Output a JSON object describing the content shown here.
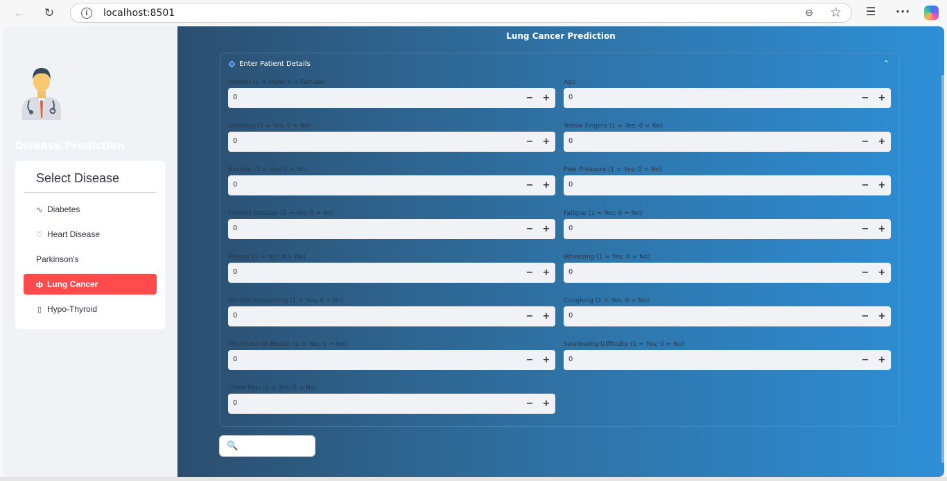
{
  "browser": {
    "url": "localhost:8501",
    "back_glyph": "←",
    "refresh_glyph": "↻",
    "info_glyph": "i",
    "zoom_glyph": "⊖",
    "favorite_glyph": "☆",
    "favorites_glyph": "☰",
    "more_glyph": "···"
  },
  "sidebar": {
    "title": "Disease Prediction",
    "menu_title": "Select Disease",
    "items": [
      {
        "label": "Diabetes",
        "icon": "activity-icon",
        "glyph": "∿",
        "active": false
      },
      {
        "label": "Heart Disease",
        "icon": "heart-icon",
        "glyph": "♡",
        "active": false
      },
      {
        "label": "Parkinson's",
        "icon": "",
        "glyph": "",
        "active": false
      },
      {
        "label": "Lung Cancer",
        "icon": "lungs-icon",
        "glyph": "ф",
        "active": true
      },
      {
        "label": "Hypo-Thyroid",
        "icon": "thermometer-icon",
        "glyph": "▯",
        "active": false
      }
    ],
    "accent_color": "#ff4b4b"
  },
  "main": {
    "title": "Lung Cancer Prediction",
    "expander_label": "Enter Patient Details",
    "collapse_glyph": "⌃",
    "fields": [
      {
        "label": "Gender (1 = Male; 0 = Female)",
        "value": "0"
      },
      {
        "label": "Age",
        "value": "0"
      },
      {
        "label": "Smoking (1 = Yes; 0 = No)",
        "value": "0"
      },
      {
        "label": "Yellow Fingers (1 = Yes; 0 = No)",
        "value": "0"
      },
      {
        "label": "Anxiety (1 = Yes; 0 = No)",
        "value": "0"
      },
      {
        "label": "Peer Pressure (1 = Yes; 0 = No)",
        "value": "0"
      },
      {
        "label": "Chronic Disease (1 = Yes; 0 = No)",
        "value": "0"
      },
      {
        "label": "Fatigue (1 = Yes; 0 = No)",
        "value": "0"
      },
      {
        "label": "Allergy (1 = Yes; 0 = No)",
        "value": "0"
      },
      {
        "label": "Wheezing (1 = Yes; 0 = No)",
        "value": "0"
      },
      {
        "label": "Alcohol Consuming (1 = Yes; 0 = No)",
        "value": "0"
      },
      {
        "label": "Coughing (1 = Yes; 0 = No)",
        "value": "0"
      },
      {
        "label": "Shortness Of Breath (1 = Yes; 0 = No)",
        "value": "0"
      },
      {
        "label": "Swallowing Difficulty (1 = Yes; 0 = No)",
        "value": "0"
      },
      {
        "label": "Chest Pain (1 = Yes; 0 = No)",
        "value": "0"
      }
    ],
    "minus_glyph": "−",
    "plus_glyph": "+",
    "predict_icon_glyph": "🔍"
  }
}
